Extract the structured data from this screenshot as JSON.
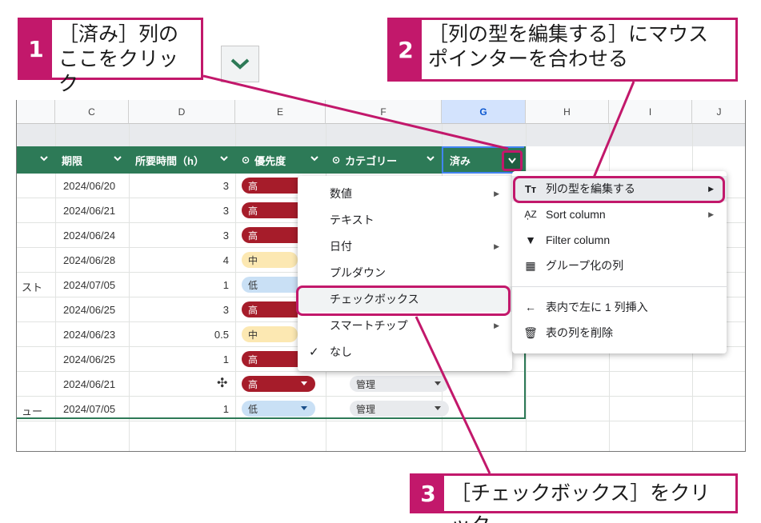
{
  "callouts": {
    "step1": {
      "num": "1",
      "text": "［済み］列の\nここをクリック"
    },
    "step2": {
      "num": "2",
      "text": "［列の型を編集する］にマウス\nポインターを合わせる"
    },
    "step3": {
      "num": "3",
      "text": "［チェックボックス］をクリック"
    }
  },
  "columns": [
    "C",
    "D",
    "E",
    "F",
    "G",
    "H",
    "I",
    "J"
  ],
  "header": {
    "deadline": "期限",
    "time": "所要時間（h）",
    "priority": "優先度",
    "category": "カテゴリー",
    "done": "済み"
  },
  "rows": [
    {
      "a": "",
      "date": "2024/06/20",
      "h": "3",
      "p": "高",
      "pt": "high",
      "cat": ""
    },
    {
      "a": "",
      "date": "2024/06/21",
      "h": "3",
      "p": "高",
      "pt": "high",
      "cat": ""
    },
    {
      "a": "",
      "date": "2024/06/24",
      "h": "3",
      "p": "高",
      "pt": "high",
      "cat": ""
    },
    {
      "a": "",
      "date": "2024/06/28",
      "h": "4",
      "p": "中",
      "pt": "mid",
      "cat": ""
    },
    {
      "a": "スト",
      "date": "2024/07/05",
      "h": "1",
      "p": "低",
      "pt": "low",
      "cat": ""
    },
    {
      "a": "",
      "date": "2024/06/25",
      "h": "3",
      "p": "高",
      "pt": "high",
      "cat": ""
    },
    {
      "a": "",
      "date": "2024/06/23",
      "h": "0.5",
      "p": "中",
      "pt": "mid",
      "cat": ""
    },
    {
      "a": "",
      "date": "2024/06/25",
      "h": "1",
      "p": "高",
      "pt": "high",
      "cat": ""
    },
    {
      "a": "",
      "date": "2024/06/21",
      "h": "",
      "p": "高",
      "pt": "high",
      "cat": "管理"
    },
    {
      "a": "ュー",
      "date": "2024/07/05",
      "h": "1",
      "p": "低",
      "pt": "low",
      "cat": "管理"
    }
  ],
  "submenu": {
    "items": [
      "数値",
      "テキスト",
      "日付",
      "プルダウン",
      "チェックボックス",
      "スマートチップ",
      "なし"
    ]
  },
  "mainmenu": {
    "edit_type": "列の型を編集する",
    "sort": "Sort column",
    "filter": "Filter column",
    "group": "グループ化の列",
    "insert_left": "表内で左に 1 列挿入",
    "delete": "表の列を削除"
  },
  "colors": {
    "accent": "#c2186b",
    "header_green": "#2d7a57",
    "high": "#a61c2a",
    "mid": "#fce8b2",
    "low": "#c9e0f5"
  }
}
